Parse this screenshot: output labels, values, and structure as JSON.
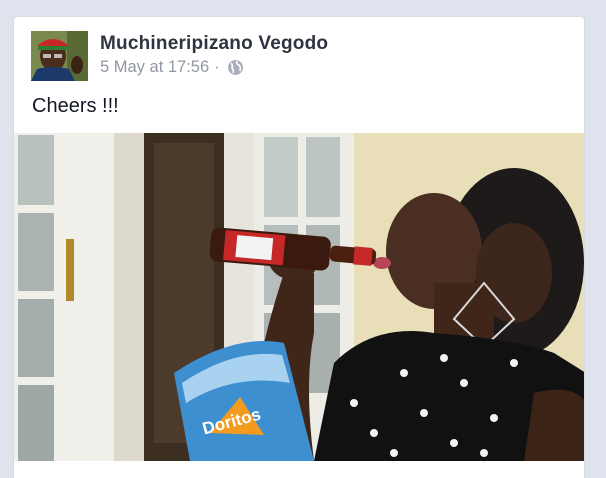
{
  "post": {
    "author": "Muchineripizano Vegodo",
    "timestamp": "5 May at 17:56",
    "separator": "·",
    "audience_icon": "globe-icon",
    "text": "Cheers !!!",
    "photo_label": "Doritos"
  },
  "colors": {
    "page_bg": "#dfe3ee",
    "card_bg": "#ffffff",
    "author_text": "#2f3440",
    "meta_text": "#9197a3"
  }
}
